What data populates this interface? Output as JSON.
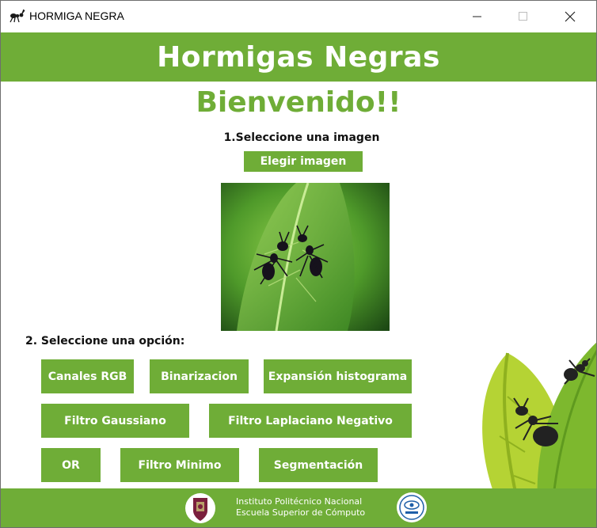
{
  "window": {
    "title": "HORMIGA NEGRA",
    "icon": "ant-icon",
    "controls": [
      "minimize-icon",
      "maximize-icon",
      "close-icon"
    ]
  },
  "header": {
    "title": "Hormigas Negras"
  },
  "welcome": "Bienvenido!!",
  "step1": {
    "label": "1.Seleccione una imagen",
    "button": "Elegir imagen"
  },
  "image": {
    "description_icon": "ants-on-leaf-photo"
  },
  "step2": {
    "label": "2. Seleccione una opción:",
    "options": [
      "Canales RGB",
      "Binarizacion",
      "Expansión histograma",
      "Filtro Gaussiano",
      "Filtro Laplaciano Negativo",
      "OR",
      "Filtro Minimo",
      "Segmentación"
    ]
  },
  "footer": {
    "line1": "Instituto Politécnico Nacional",
    "line2": "Escuela Superior de Cómputo",
    "logos": [
      "ipn-logo",
      "escom-logo"
    ]
  },
  "colors": {
    "accent": "#6fad37",
    "text": "#111111",
    "white": "#ffffff"
  }
}
